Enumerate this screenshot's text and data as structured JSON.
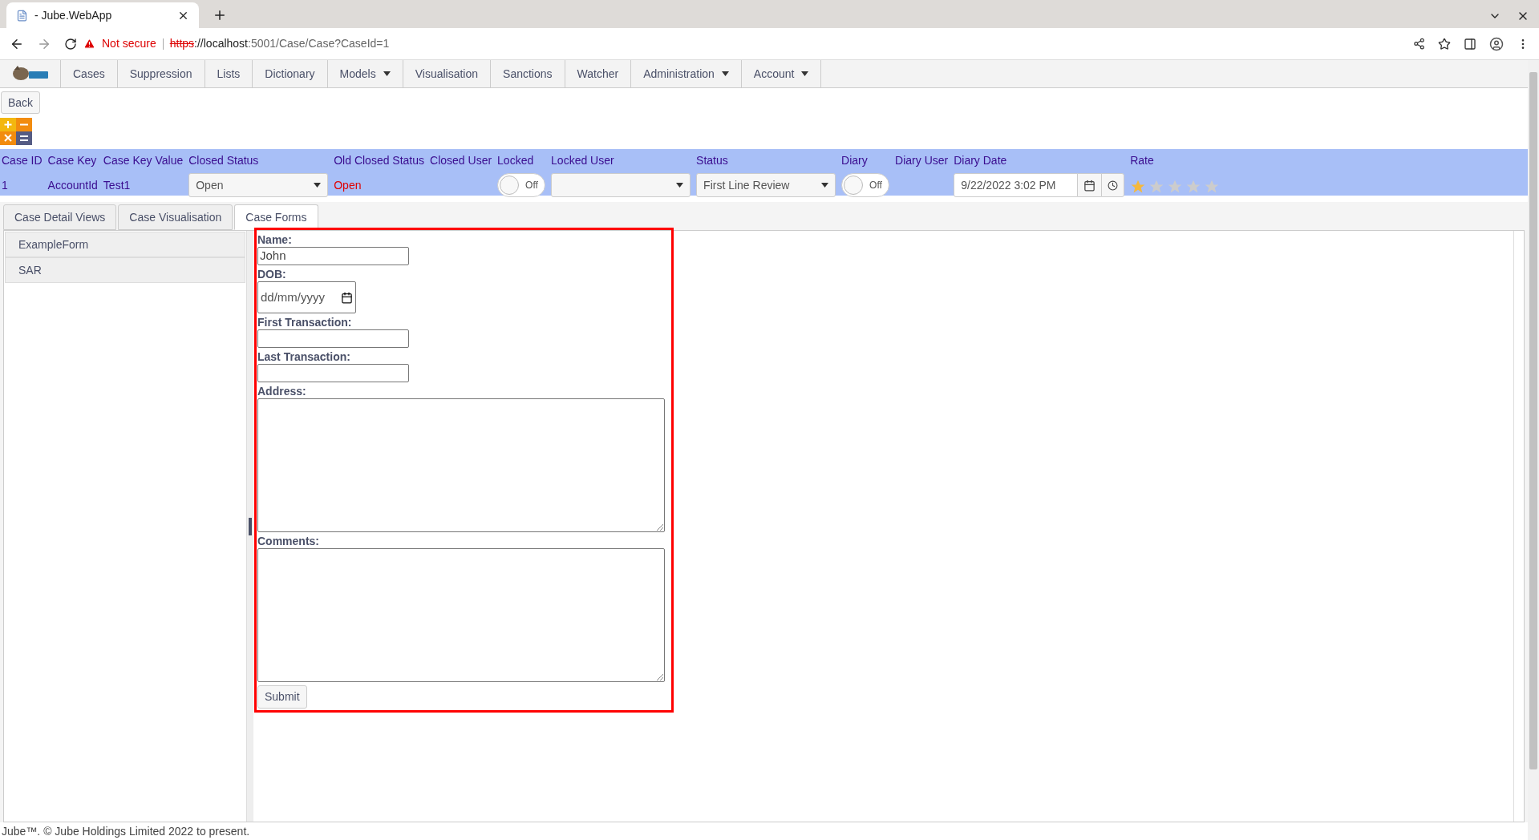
{
  "browser": {
    "tab_title": "- Jube.WebApp",
    "security": "Not secure",
    "url_scheme": "https",
    "url_host": "://localhost",
    "url_path": ":5001/Case/Case?CaseId=1"
  },
  "nav": [
    {
      "label": "Cases",
      "dropdown": false
    },
    {
      "label": "Suppression",
      "dropdown": false
    },
    {
      "label": "Lists",
      "dropdown": false
    },
    {
      "label": "Dictionary",
      "dropdown": false
    },
    {
      "label": "Models",
      "dropdown": true
    },
    {
      "label": "Visualisation",
      "dropdown": false
    },
    {
      "label": "Sanctions",
      "dropdown": false
    },
    {
      "label": "Watcher",
      "dropdown": false
    },
    {
      "label": "Administration",
      "dropdown": true
    },
    {
      "label": "Account",
      "dropdown": true
    }
  ],
  "back_button": "Back",
  "case_fields": [
    {
      "label": "Case ID",
      "kind": "text",
      "value": "1"
    },
    {
      "label": "Case Key",
      "kind": "text",
      "value": "AccountId"
    },
    {
      "label": "Case Key Value",
      "kind": "text",
      "value": "Test1"
    },
    {
      "label": "Closed Status",
      "kind": "select",
      "value": "Open"
    },
    {
      "label": "Old Closed Status",
      "kind": "alert",
      "value": "Open"
    },
    {
      "label": "Closed User",
      "kind": "text"
    },
    {
      "label": "Locked",
      "kind": "toggle",
      "on": false,
      "value": "Off"
    },
    {
      "label": "Locked User",
      "kind": "select"
    },
    {
      "label": "Status",
      "kind": "select",
      "value": "First Line Review"
    },
    {
      "label": "Diary",
      "kind": "toggle",
      "on": false,
      "value": "Off"
    },
    {
      "label": "Diary User",
      "kind": "text"
    },
    {
      "label": "Diary Date",
      "kind": "datetime",
      "value": "9/22/2022 3:02 PM"
    },
    {
      "label": "Rate",
      "kind": "stars",
      "stars": 1
    }
  ],
  "tabs": [
    {
      "label": "Case Detail Views",
      "selected": false
    },
    {
      "label": "Case Visualisation",
      "selected": false
    },
    {
      "label": "Case Forms",
      "selected": true
    }
  ],
  "forms": [
    "ExampleForm",
    "SAR"
  ],
  "form_fields": [
    {
      "label": "Name:",
      "kind": "text",
      "value": "John"
    },
    {
      "label": "DOB:",
      "kind": "date",
      "placeholder": "dd/mm/yyyy"
    },
    {
      "label": "First Transaction:",
      "kind": "text"
    },
    {
      "label": "Last Transaction:",
      "kind": "text"
    },
    {
      "label": "Address:",
      "kind": "textarea"
    },
    {
      "label": "Comments:",
      "kind": "textarea"
    }
  ],
  "submit_button": "Submit",
  "footer": "Jube™. © Jube Holdings Limited 2022 to present."
}
